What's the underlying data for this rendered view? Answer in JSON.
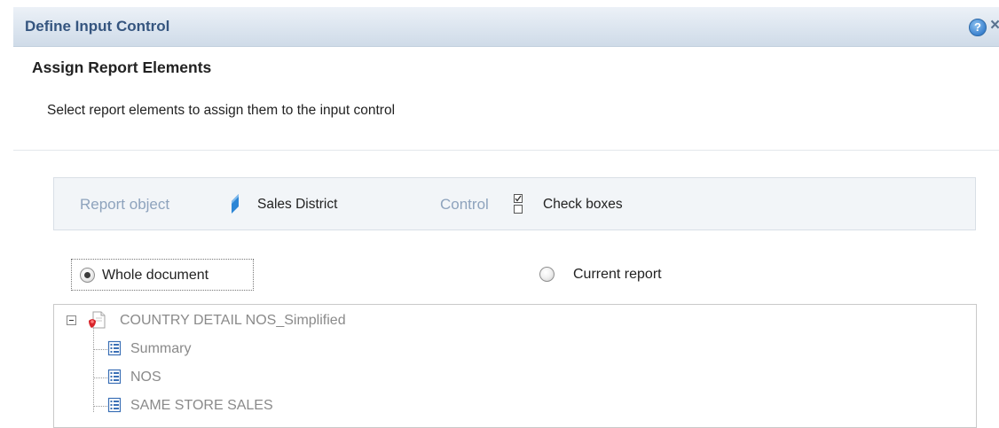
{
  "dialog": {
    "title": "Define Input Control",
    "help_glyph": "?",
    "close_glyph": "×"
  },
  "section": {
    "title": "Assign Report Elements",
    "description": "Select report elements to assign them to the input control"
  },
  "info_bar": {
    "report_object_label": "Report object",
    "report_object_value": "Sales District",
    "report_object_icon": "dimension-icon",
    "control_label": "Control",
    "control_value": "Check boxes",
    "control_icon": "checkboxes-icon"
  },
  "scope": {
    "options": [
      {
        "label": "Whole document",
        "selected": true
      },
      {
        "label": "Current report",
        "selected": false
      }
    ]
  },
  "tree": {
    "root": {
      "label": "COUNTRY DETAIL NOS_Simplified",
      "icon": "document-icon",
      "expanded": true
    },
    "children": [
      {
        "label": "Summary",
        "icon": "report-icon"
      },
      {
        "label": "NOS",
        "icon": "report-icon"
      },
      {
        "label": "SAME STORE SALES",
        "icon": "report-icon"
      }
    ]
  },
  "colors": {
    "title_text": "#35557f",
    "muted_label": "#8ea3bd",
    "tree_text": "#8a8a8a",
    "dimension_icon": "#2c86d6"
  }
}
